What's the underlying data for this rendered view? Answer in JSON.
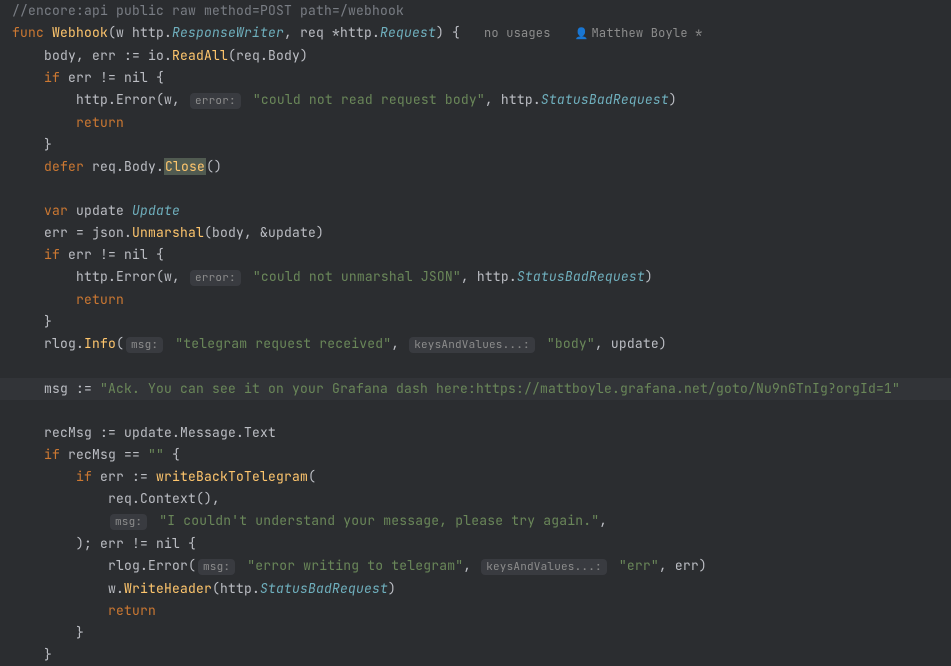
{
  "meta": {
    "usages": "no usages",
    "author": "Matthew Boyle *"
  },
  "code": {
    "l1_comment": "//encore:api public raw method=POST path=/webhook",
    "l2_func": "func",
    "l2_name": "Webhook",
    "l2_w": "w",
    "l2_rw": "ResponseWriter",
    "l2_req": "req",
    "l2_reqtype": "Request",
    "l3_body": "body",
    "l3_err": "err",
    "l3_readall": "ReadAll",
    "l3_reqbody": "req.Body",
    "l4_if": "if",
    "l4_cond": "err != nil {",
    "l5_httpError": "http.Error",
    "l5_str": "\"could not read request body\"",
    "l5_status": "StatusBadRequest",
    "l6_return": "return",
    "l7_brace": "}",
    "l8_defer": "defer",
    "l8_close": "Close",
    "l10_var": "var",
    "l10_update": "update",
    "l10_Update": "Update",
    "l11_unmarshal": "Unmarshal",
    "l11_args": "(body, &update)",
    "l14_str": "\"could not unmarshal JSON\"",
    "l16_info": "Info",
    "l16_msg": "\"telegram request received\"",
    "l16_body": "\"body\"",
    "l16_update": "update",
    "l18_ack": "\"Ack. You can see it on your Grafana dash here:https://mattboyle.grafana.net/goto/Nu9nGTnIg?orgId=1\"",
    "l20_recmsg": "recMsg := update.Message.Text",
    "l21_if": "if recMsg == \"\" {",
    "l22_write": "writeBackToTelegram",
    "l23_ctx": "req.Context(),",
    "l24_str": "\"I couldn't understand your message, please try again.\"",
    "l25_close": "); err != nil {",
    "l26_errstr": "\"error writing to telegram\"",
    "l26_errkey": "\"err\"",
    "l27_writeheader": "WriteHeader"
  },
  "hints": {
    "error": "error:",
    "msg": "msg:",
    "kv": "keysAndValues...:"
  }
}
